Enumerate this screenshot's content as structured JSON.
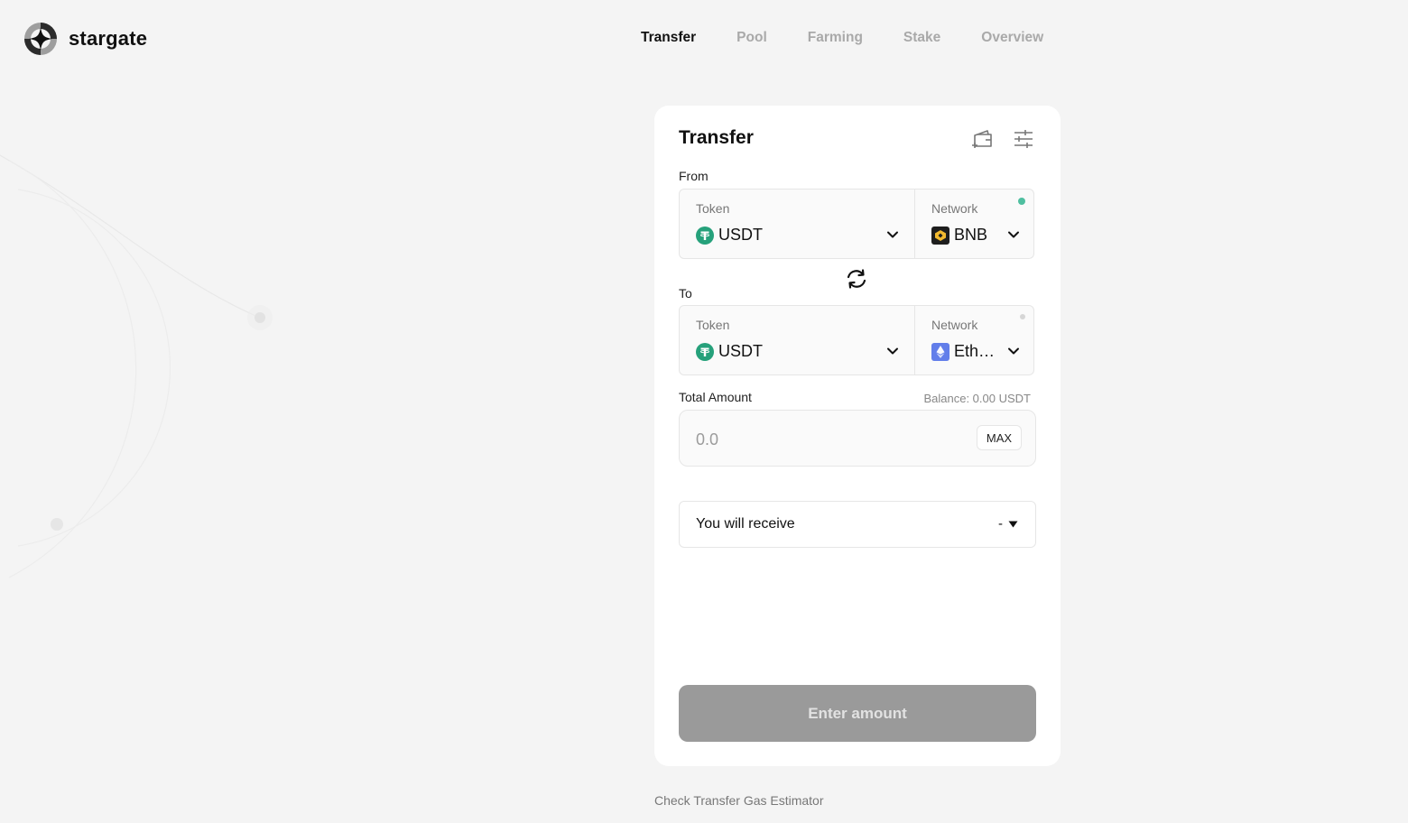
{
  "brand": {
    "name": "stargate"
  },
  "nav": {
    "items": [
      {
        "label": "Transfer",
        "active": true
      },
      {
        "label": "Pool",
        "active": false
      },
      {
        "label": "Farming",
        "active": false
      },
      {
        "label": "Stake",
        "active": false
      },
      {
        "label": "Overview",
        "active": false
      }
    ]
  },
  "card": {
    "title": "Transfer",
    "tools": {
      "wallet_icon": "wallet-add-icon",
      "settings_icon": "sliders-icon"
    }
  },
  "from": {
    "label": "From",
    "token_label": "Token",
    "token_value": "USDT",
    "token_icon": "usdt-icon",
    "network_label": "Network",
    "network_value": "BNB",
    "network_icon": "bnb-icon",
    "status_color": "#4fbfa0"
  },
  "swap": {
    "icon": "swap-arrows-icon"
  },
  "to": {
    "label": "To",
    "token_label": "Token",
    "token_value": "USDT",
    "token_icon": "usdt-icon",
    "network_label": "Network",
    "network_value": "Ethe…",
    "network_icon": "ethereum-icon",
    "status_color": "#d6d6d6"
  },
  "amount": {
    "label": "Total Amount",
    "balance": "Balance: 0.00 USDT",
    "placeholder": "0.0",
    "max_label": "MAX"
  },
  "receive": {
    "label": "You will receive",
    "value": "-"
  },
  "submit": {
    "label": "Enter amount"
  },
  "footer": {
    "gas_link": "Check Transfer Gas Estimator"
  },
  "colors": {
    "background": "#f4f4f4",
    "card": "#ffffff",
    "tether_green": "#26a17b",
    "bnb_gold": "#f3ba2f",
    "eth_purple": "#627eea",
    "button_disabled": "#9a9a9a"
  }
}
